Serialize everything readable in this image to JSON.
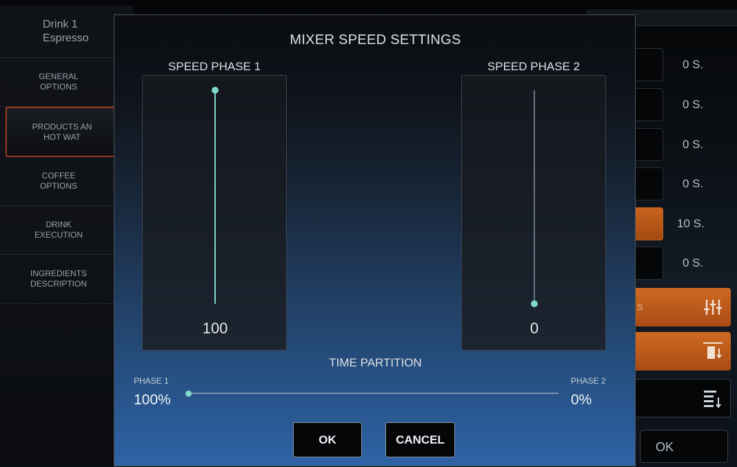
{
  "sidebar": {
    "drink_name": "Drink 1",
    "drink_type": "Espresso",
    "items": [
      {
        "line1": "GENERAL",
        "line2": "OPTIONS"
      },
      {
        "line1": "PRODUCTS AN",
        "line2": "HOT WAT"
      },
      {
        "line1": "COFFEE",
        "line2": "OPTIONS"
      },
      {
        "line1": "DRINK",
        "line2": "EXECUTION"
      },
      {
        "line1": "INGREDIENTS",
        "line2": "DESCRIPTION"
      }
    ]
  },
  "right_panel": {
    "values": [
      "0 S.",
      "0 S.",
      "0 S.",
      "0 S.",
      "10 S.",
      "0 S."
    ],
    "highlighted_index": 4,
    "settings_fragment": "S",
    "ok_label": "OK",
    "colors": {
      "orange": "#c8641e"
    }
  },
  "dialog": {
    "title": "MIXER SPEED SETTINGS",
    "phase1": {
      "label": "SPEED PHASE 1",
      "value": "100",
      "level": 1.0
    },
    "phase2": {
      "label": "SPEED PHASE 2",
      "value": "0",
      "level": 0.0
    },
    "time_partition": {
      "title": "TIME PARTITION",
      "phase1_label": "PHASE 1",
      "phase1_value": "100%",
      "phase2_label": "PHASE 2",
      "phase2_value": "0%",
      "position": 0.0
    },
    "ok_label": "OK",
    "cancel_label": "CANCEL",
    "accent_color": "#7fd8cc"
  }
}
